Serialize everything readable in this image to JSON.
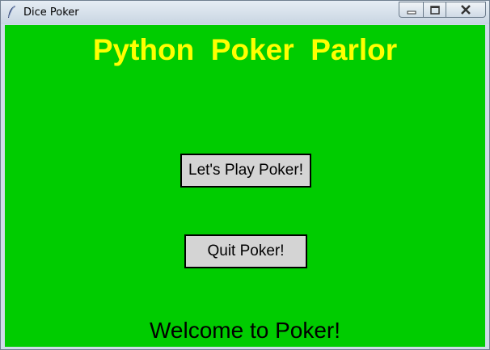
{
  "window": {
    "title": "Dice Poker",
    "icon": "feather-icon"
  },
  "controls": {
    "minimize_icon": "minimize-icon",
    "maximize_icon": "maximize-icon",
    "close_icon": "close-icon"
  },
  "main": {
    "heading": "Python  Poker  Parlor",
    "play_button_label": "Let's Play Poker!",
    "quit_button_label": "Quit Poker!",
    "status_text": "Welcome to Poker!"
  },
  "colors": {
    "background": "#00cc00",
    "heading": "#ffff00",
    "button_face": "#d4d4d4"
  }
}
